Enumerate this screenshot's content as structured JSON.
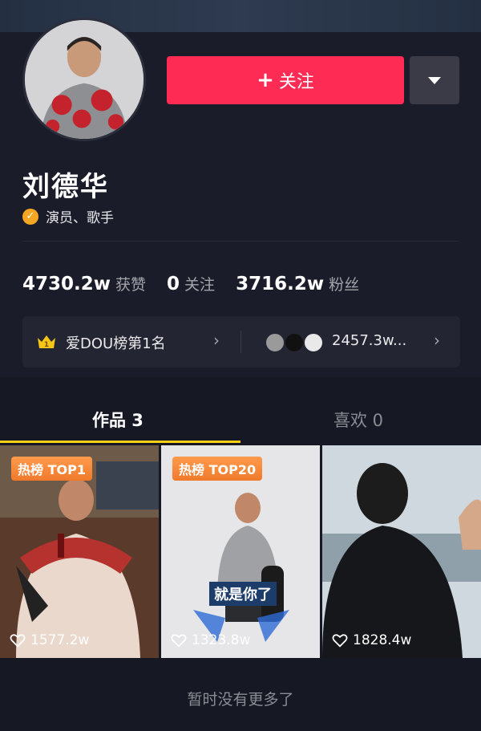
{
  "profile": {
    "name": "刘德华",
    "verification": "演员、歌手"
  },
  "actions": {
    "follow_icon": "+",
    "follow_label": "关注"
  },
  "stats": [
    {
      "value": "4730.2w",
      "label": "获赞"
    },
    {
      "value": "0",
      "label": "关注"
    },
    {
      "value": "3716.2w",
      "label": "粉丝"
    }
  ],
  "rank": {
    "crown_badge": "1",
    "label": "爱DOU榜第1名",
    "fans_count": "2457.3w..."
  },
  "tabs": [
    {
      "label": "作品 3",
      "active": true
    },
    {
      "label": "喜欢 0",
      "active": false
    }
  ],
  "videos": [
    {
      "badge": "热榜 TOP1",
      "likes": "1577.2w"
    },
    {
      "badge": "热榜 TOP20",
      "likes": "1323.8w",
      "caption": "就是你了"
    },
    {
      "badge": "",
      "likes": "1828.4w"
    }
  ],
  "footer": {
    "no_more": "暂时没有更多了"
  },
  "colors": {
    "background": "#161823",
    "follow_button": "#fe2c55",
    "tab_underline": "#face15",
    "verify_badge": "#f5a623",
    "hot_badge": "#f07a2c"
  },
  "icons": {
    "verify": "verified-check-icon",
    "dropdown": "triangle-down-icon",
    "crown": "crown-icon",
    "chevron": "chevron-right-icon",
    "heart": "heart-outline-icon"
  }
}
